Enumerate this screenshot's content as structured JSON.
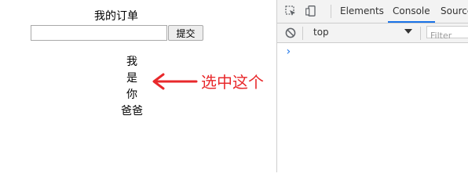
{
  "page": {
    "title": "我的订单",
    "search_placeholder": "",
    "submit_label": "提交",
    "poem_lines": [
      "我",
      "是",
      "你",
      "爸爸"
    ],
    "annotation": "选中这个",
    "annotation_color": "#e8282b"
  },
  "devtools": {
    "tabs": [
      {
        "label": "Elements",
        "active": false
      },
      {
        "label": "Console",
        "active": true
      },
      {
        "label": "Source",
        "active": false
      }
    ],
    "context": "top",
    "filter_placeholder": "Filter",
    "prompt_symbol": "›",
    "accent": "#1a73e8"
  }
}
